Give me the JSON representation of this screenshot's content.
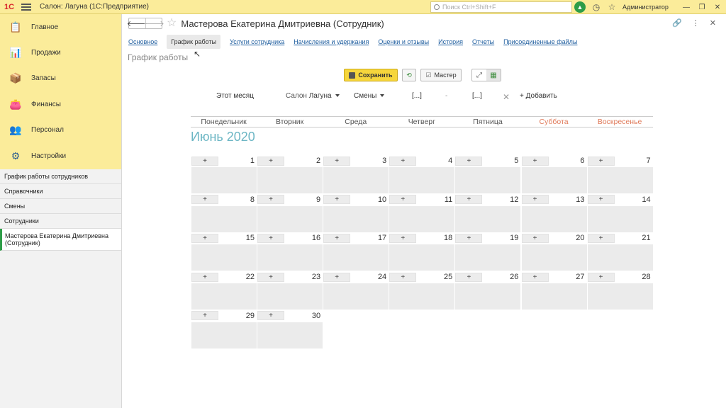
{
  "app": {
    "logo": "1С",
    "title": "Салон: Лагуна  (1С:Предприятие)",
    "search_placeholder": "Поиск Ctrl+Shift+F",
    "user": "Администратор"
  },
  "sidebar": {
    "sections": [
      {
        "label": "Главное",
        "icon": "clipboard-icon",
        "color": "#7a5a2a"
      },
      {
        "label": "Продажи",
        "icon": "sales-chart-icon",
        "color": "#c0392b"
      },
      {
        "label": "Запасы",
        "icon": "stock-icon",
        "color": "#d4a017"
      },
      {
        "label": "Финансы",
        "icon": "wallet-icon",
        "color": "#3a7d2c"
      },
      {
        "label": "Персонал",
        "icon": "people-icon",
        "color": "#b5651d"
      },
      {
        "label": "Настройки",
        "icon": "gear-icon",
        "color": "#2f5f8f"
      }
    ],
    "nav": [
      "График работы сотрудников",
      "Справочники",
      "Смены",
      "Сотрудники"
    ],
    "open_window": "Мастерова Екатерина Дмитриевна (Сотрудник)"
  },
  "form": {
    "title": "Мастерова Екатерина Дмитриевна (Сотрудник)",
    "tabs": [
      {
        "label": "Основное",
        "active": false
      },
      {
        "label": "График работы",
        "active": true
      },
      {
        "label": "Услуги сотрудника",
        "active": false
      },
      {
        "label": "Начисления и удержания",
        "active": false
      },
      {
        "label": "Оценки и отзывы",
        "active": false
      },
      {
        "label": "История",
        "active": false
      },
      {
        "label": "Отчеты",
        "active": false
      },
      {
        "label": "Присоединенные файлы",
        "active": false
      }
    ],
    "subtitle": "График работы"
  },
  "toolbar": {
    "save_label": "Сохранить",
    "master_label": "Мастер"
  },
  "filters": {
    "period": "Этот месяц",
    "salon_label": "Салон",
    "salon_value": "Лагуна",
    "shifts_label": "Смены",
    "from": "[...]",
    "dash": "-",
    "to": "[...]",
    "clear": "✕",
    "add_label": "+ Добавить"
  },
  "calendar": {
    "weekdays": [
      "Понедельник",
      "Вторник",
      "Среда",
      "Четверг",
      "Пятница",
      "Суббота",
      "Воскресенье"
    ],
    "weekend_color": "#e07b5b",
    "month_title": "Июнь 2020",
    "month_color": "#6cb6c4",
    "plus_label": "+",
    "days": [
      "1",
      "2",
      "3",
      "4",
      "5",
      "6",
      "7",
      "8",
      "9",
      "10",
      "11",
      "12",
      "13",
      "14",
      "15",
      "16",
      "17",
      "18",
      "19",
      "20",
      "21",
      "22",
      "23",
      "24",
      "25",
      "26",
      "27",
      "28",
      "29",
      "30"
    ]
  }
}
